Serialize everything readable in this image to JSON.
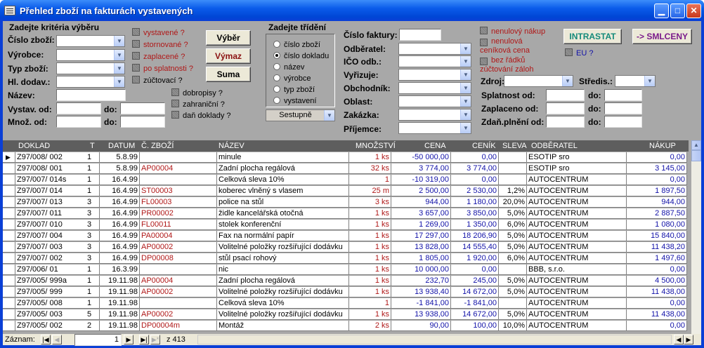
{
  "window": {
    "title": "Přehled zboží na fakturách vystavených"
  },
  "filters": {
    "heading": "Zadejte kritéria výběru",
    "cislo_zbozi": "Číslo zboží:",
    "vyrobce": "Výrobce:",
    "typ_zbozi": "Typ zboží:",
    "hl_dodav": "Hl. dodav.:",
    "nazev": "Název:",
    "vystav_od": "Vystav. od:",
    "mnoz_od": "Množ. od:",
    "do": "do:"
  },
  "checks1": [
    "vystavené ?",
    "stornované ?",
    "zaplacené ?",
    "po splatnosti ?",
    "zúčtovací ?"
  ],
  "checks2": [
    "dobropisy ?",
    "zahraniční ?",
    "daň doklady ?"
  ],
  "buttons": {
    "vyber": "Výběr",
    "vymaz": "Výmaz",
    "suma": "Suma",
    "intrastat": "INTRASTAT",
    "smlceny": "-> SMLCENY"
  },
  "sort": {
    "heading": "Zadejte třídění",
    "options": [
      "číslo zboží",
      "číslo dokladu",
      "název",
      "výrobce",
      "typ zboží",
      "vystavení"
    ],
    "selected": 1,
    "order": "Sestupně"
  },
  "right": {
    "cislo_faktury": "Číslo faktury:",
    "odberatel": "Odběratel:",
    "ico": "IČO odb.:",
    "vyrizuje": "Vyřizuje:",
    "obchodnik": "Obchodník:",
    "oblast": "Oblast:",
    "zakazka": "Zakázka:",
    "prijemce": "Příjemce:",
    "checks": [
      "nenulový nákup",
      "nenulová ceníková cena",
      "bez řádků zúčtování záloh"
    ],
    "eu": "EU ?",
    "zdroj": "Zdroj:",
    "stredis": "Středis.:",
    "splatnost": "Splatnost od:",
    "zaplaceno": "Zaplaceno od:",
    "zdan": "Zdaň.plnění od:",
    "do": "do:"
  },
  "table": {
    "headers": [
      "DOKLAD",
      "T",
      "DATUM",
      "Č. ZBOŽÍ",
      "NÁZEV",
      "MNOŽSTVÍ",
      "CENA",
      "CENÍK",
      "SLEVA",
      "ODBĚRATEL",
      "NÁKUP"
    ],
    "rows": [
      [
        "Z97/008/ 002",
        "1",
        "5.8.99",
        "",
        "minule",
        "1 ks",
        "-50 000,00",
        "0,00",
        "",
        "ESOTIP sro",
        "0,00"
      ],
      [
        "Z97/008/ 001",
        "1",
        "5.8.99",
        "AP00004",
        "Zadní plocha regálová",
        "32 ks",
        "3 774,00",
        "3 774,00",
        "",
        "ESOTIP sro",
        "3 145,00"
      ],
      [
        "Z97/007/ 014s",
        "1",
        "16.4.99",
        "",
        "Celková sleva 10%",
        "1",
        "-10 319,00",
        "0,00",
        "",
        "AUTOCENTRUM",
        "0,00"
      ],
      [
        "Z97/007/ 014",
        "1",
        "16.4.99",
        "ST00003",
        "koberec vlněný s vlasem",
        "25 m",
        "2 500,00",
        "2 530,00",
        "1,2%",
        "AUTOCENTRUM",
        "1 897,50"
      ],
      [
        "Z97/007/ 013",
        "3",
        "16.4.99",
        "FL00003",
        "police na stůl",
        "3 ks",
        "944,00",
        "1 180,00",
        "20,0%",
        "AUTOCENTRUM",
        "944,00"
      ],
      [
        "Z97/007/ 011",
        "3",
        "16.4.99",
        "PR00002",
        "židle kancelářská otočná",
        "1 ks",
        "3 657,00",
        "3 850,00",
        "5,0%",
        "AUTOCENTRUM",
        "2 887,50"
      ],
      [
        "Z97/007/ 010",
        "3",
        "16.4.99",
        "FL00011",
        "stolek konferenční",
        "1 ks",
        "1 269,00",
        "1 350,00",
        "6,0%",
        "AUTOCENTRUM",
        "1 080,00"
      ],
      [
        "Z97/007/ 004",
        "3",
        "16.4.99",
        "PA00004",
        "Fax na normální papír",
        "1 ks",
        "17 297,00",
        "18 206,90",
        "5,0%",
        "AUTOCENTRUM",
        "15 840,00"
      ],
      [
        "Z97/007/ 003",
        "3",
        "16.4.99",
        "AP00002",
        "Volitelné položky rozšiřující dodávku",
        "1 ks",
        "13 828,00",
        "14 555,40",
        "5,0%",
        "AUTOCENTRUM",
        "11 438,20"
      ],
      [
        "Z97/007/ 002",
        "3",
        "16.4.99",
        "DP00008",
        "stůl psací rohový",
        "1 ks",
        "1 805,00",
        "1 920,00",
        "6,0%",
        "AUTOCENTRUM",
        "1 497,60"
      ],
      [
        "Z97/006/ 01",
        "1",
        "16.3.99",
        "",
        "nic",
        "1 ks",
        "10 000,00",
        "0,00",
        "",
        "BBB, s.r.o.",
        "0,00"
      ],
      [
        "Z97/005/ 999a",
        "1",
        "19.11.98",
        "AP00004",
        "Zadní plocha regálová",
        "1 ks",
        "232,70",
        "245,00",
        "5,0%",
        "AUTOCENTRUM",
        "4 500,00"
      ],
      [
        "Z97/005/ 999",
        "1",
        "19.11.98",
        "AP00002",
        "Volitelné položky rozšiřující dodávku",
        "1 ks",
        "13 938,40",
        "14 672,00",
        "5,0%",
        "AUTOCENTRUM",
        "11 438,00"
      ],
      [
        "Z97/005/ 008",
        "1",
        "19.11.98",
        "",
        "Celková sleva 10%",
        "1",
        "-1 841,00",
        "-1 841,00",
        "",
        "AUTOCENTRUM",
        "0,00"
      ],
      [
        "Z97/005/ 003",
        "5",
        "19.11.98",
        "AP00002",
        "Volitelné položky rozšiřující dodávku",
        "1 ks",
        "13 938,00",
        "14 672,00",
        "5,0%",
        "AUTOCENTRUM",
        "11 438,00"
      ],
      [
        "Z97/005/ 002",
        "2",
        "19.11.98",
        "DP00004m",
        "Montáž",
        "2 ks",
        "90,00",
        "100,00",
        "10,0%",
        "AUTOCENTRUM",
        "0,00"
      ]
    ]
  },
  "nav": {
    "label": "Záznam:",
    "current": "1",
    "total": "z 413"
  }
}
